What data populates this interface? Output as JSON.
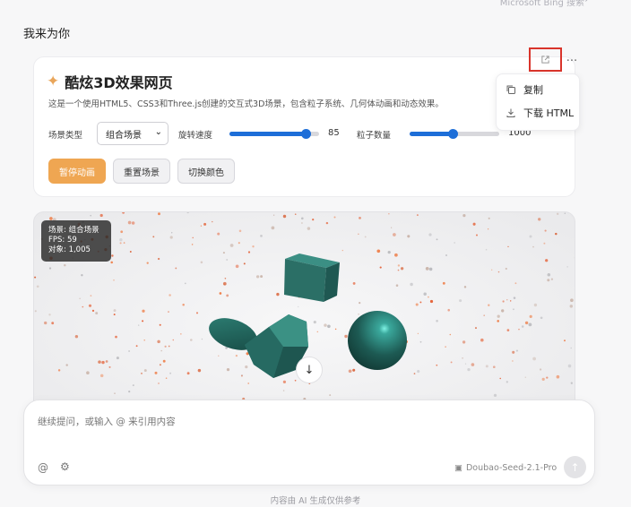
{
  "header": {
    "hint_text": "Microsoft Bing 搜索",
    "hint_icon": "arrow-up-right-icon"
  },
  "prompt": "我来为你",
  "card": {
    "title": "酷炫3D效果网页",
    "description": "这是一个使用HTML5、CSS3和Three.js创建的交互式3D场景，包含粒子系统、几何体动画和动态效果。",
    "scene_type_label": "场景类型",
    "scene_type_value": "组合场景",
    "rotation_label": "旋转速度",
    "rotation_value": "85",
    "rotation_fraction": 0.85,
    "particle_label": "粒子数量",
    "particle_value": "1000",
    "particle_fraction": 0.48,
    "buttons": {
      "pause": "暂停动画",
      "reset": "重置场景",
      "color": "切换颜色"
    }
  },
  "menu": {
    "copy_label": "复制",
    "download_label": "下载 HTML"
  },
  "preview": {
    "stats_scene": "场景: 组合场景",
    "stats_fps": "FPS: 59",
    "stats_objects": "对象: 1,005"
  },
  "composer": {
    "placeholder": "继续提问，或输入 @ 来引用内容",
    "model": "Doubao-Seed-2.1-Pro"
  },
  "footer": {
    "disclaimer": "内容由 AI 生成仅供参考"
  },
  "colors": {
    "accent": "#efa652",
    "slider": "#1d6ed8",
    "highlight_border": "#d9342b",
    "shape": "#2f7a70"
  }
}
